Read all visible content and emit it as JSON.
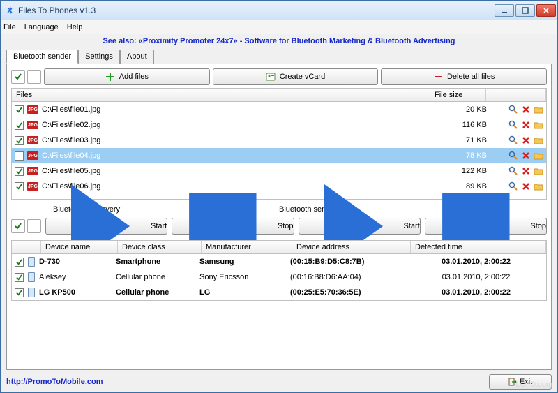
{
  "window": {
    "title": "Files To Phones v1.3"
  },
  "menu": {
    "file": "File",
    "language": "Language",
    "help": "Help"
  },
  "banner": {
    "text": "See also: «Proximity Promoter 24x7» - Software for Bluetooth Marketing & Bluetooth Advertising"
  },
  "tabs": {
    "sender": "Bluetooth sender",
    "settings": "Settings",
    "about": "About"
  },
  "toolbar": {
    "add_files": "Add files",
    "create_vcard": "Create vCard",
    "delete_all": "Delete all files"
  },
  "files_header": {
    "files": "Files",
    "size": "File size"
  },
  "files": [
    {
      "checked": true,
      "path": "C:\\Files\\file01.jpg",
      "size": "20 KB",
      "selected": false
    },
    {
      "checked": true,
      "path": "C:\\Files\\file02.jpg",
      "size": "116 KB",
      "selected": false
    },
    {
      "checked": true,
      "path": "C:\\Files\\file03.jpg",
      "size": "71 KB",
      "selected": false
    },
    {
      "checked": false,
      "path": "C:\\Files\\file04.jpg",
      "size": "78 KB",
      "selected": true
    },
    {
      "checked": true,
      "path": "C:\\Files\\file05.jpg",
      "size": "122 KB",
      "selected": false
    },
    {
      "checked": true,
      "path": "C:\\Files\\file06.jpg",
      "size": "89 KB",
      "selected": false
    }
  ],
  "discovery": {
    "label": "Bluetooth discovery:",
    "sender_label": "Bluetooth sender:",
    "start": "Start",
    "stop": "Stop"
  },
  "dev_header": {
    "name": "Device name",
    "class": "Device class",
    "manu": "Manufacturer",
    "addr": "Device address",
    "time": "Detected time"
  },
  "devices": [
    {
      "checked": true,
      "bold": true,
      "name": "D-730",
      "class": "Smartphone",
      "manu": "Samsung",
      "addr": "(00:15:B9:D5:C8:7B)",
      "time": "03.01.2010, 2:00:22"
    },
    {
      "checked": true,
      "bold": false,
      "name": "Aleksey",
      "class": "Cellular phone",
      "manu": "Sony Ericsson",
      "addr": "(00:16:B8:D6:AA:04)",
      "time": "03.01.2010, 2:00:22"
    },
    {
      "checked": true,
      "bold": true,
      "name": "LG KP500",
      "class": "Cellular phone",
      "manu": "LG",
      "addr": "(00:25:E5:70:36:5E)",
      "time": "03.01.2010, 2:00:22"
    }
  ],
  "footer": {
    "url": "http://PromoToMobile.com",
    "exit": "Exit"
  },
  "watermark": "LO4D.com"
}
